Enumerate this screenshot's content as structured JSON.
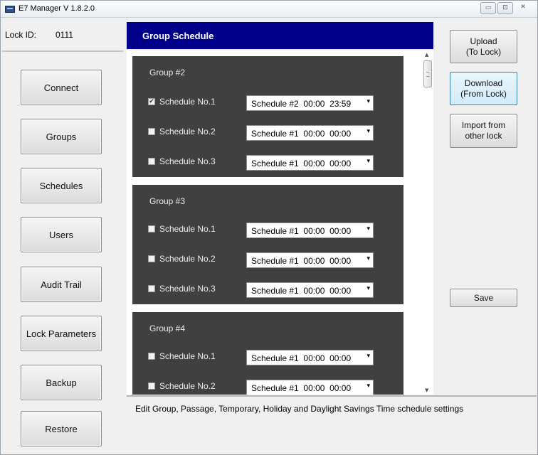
{
  "window": {
    "title": "E7 Manager V 1.8.2.0",
    "controls": {
      "minimize": "▭",
      "maximize": "⊡",
      "close": "✕"
    }
  },
  "lock": {
    "label": "Lock ID:",
    "value": "0111"
  },
  "nav": [
    {
      "label": "Connect"
    },
    {
      "label": "Groups"
    },
    {
      "label": "Schedules"
    },
    {
      "label": "Users"
    },
    {
      "label": "Audit Trail"
    },
    {
      "label": "Lock Parameters"
    },
    {
      "label": "Backup"
    },
    {
      "label": "Restore"
    }
  ],
  "content": {
    "title": "Group Schedule",
    "groups": [
      {
        "title": "Group #2",
        "schedules": [
          {
            "label": "Schedule No.1",
            "checked": true,
            "value": "Schedule #2  00:00  23:59"
          },
          {
            "label": "Schedule No.2",
            "checked": false,
            "value": "Schedule #1  00:00  00:00"
          },
          {
            "label": "Schedule No.3",
            "checked": false,
            "value": "Schedule #1  00:00  00:00"
          }
        ]
      },
      {
        "title": "Group #3",
        "schedules": [
          {
            "label": "Schedule No.1",
            "checked": false,
            "value": "Schedule #1  00:00  00:00"
          },
          {
            "label": "Schedule No.2",
            "checked": false,
            "value": "Schedule #1  00:00  00:00"
          },
          {
            "label": "Schedule No.3",
            "checked": false,
            "value": "Schedule #1  00:00  00:00"
          }
        ]
      },
      {
        "title": "Group #4",
        "schedules": [
          {
            "label": "Schedule No.1",
            "checked": false,
            "value": "Schedule #1  00:00  00:00"
          },
          {
            "label": "Schedule No.2",
            "checked": false,
            "value": "Schedule #1  00:00  00:00"
          }
        ]
      }
    ],
    "dropdown_arrow": "▾",
    "check_mark": "✔",
    "scroll_up": "▲",
    "scroll_down": "▼"
  },
  "description": "Edit Group, Passage, Temporary, Holiday and Daylight Savings Time schedule settings",
  "actions": {
    "upload": "Upload\n(To Lock)",
    "download": "Download\n(From Lock)",
    "import": "Import from\nother lock",
    "save": "Save"
  },
  "colors": {
    "header_bg": "#00008b",
    "panel_bg": "#404040",
    "focus_border": "#3c7fb1"
  }
}
